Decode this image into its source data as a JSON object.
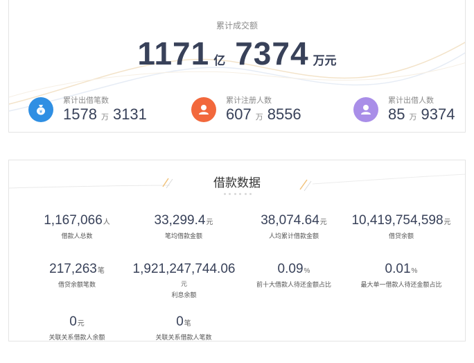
{
  "summary": {
    "caption": "累计成交额",
    "amount_yi": "1171",
    "unit_yi": "亿",
    "amount_wan": "7374",
    "unit_wanyuan": "万元",
    "colors": {
      "number": "#384159",
      "accent_blue": "#2f8fe3",
      "accent_orange": "#f2683c",
      "accent_purple": "#a98ee8"
    }
  },
  "stats": [
    {
      "label": "累计出借笔数",
      "part1": "1578",
      "unit": "万",
      "part2": "3131",
      "icon": "money-bag-icon"
    },
    {
      "label": "累计注册人数",
      "part1": "607",
      "unit": "万",
      "part2": "8556",
      "icon": "user-icon"
    },
    {
      "label": "累计出借人数",
      "part1": "85",
      "unit": "万",
      "part2": "9374",
      "icon": "user-icon"
    }
  ],
  "loan": {
    "title": "借款数据",
    "items": [
      {
        "value": "1,167,066",
        "unit": "人",
        "label": "借款人总数"
      },
      {
        "value": "33,299.4",
        "unit": "元",
        "label": "笔均借款金额"
      },
      {
        "value": "38,074.64",
        "unit": "元",
        "label": "人均累计借款金额"
      },
      {
        "value": "10,419,754,598",
        "unit": "元",
        "label": "借贷余额"
      },
      {
        "value": "217,263",
        "unit": "笔",
        "label": "借贷余额笔数"
      },
      {
        "value": "1,921,247,744.06",
        "unit": "元",
        "label": "利息余额"
      },
      {
        "value": "0.09",
        "unit": "%",
        "label": "前十大借款人待还金额占比"
      },
      {
        "value": "0.01",
        "unit": "%",
        "label": "最大单一借款人待还金额占比"
      },
      {
        "value": "0",
        "unit": "元",
        "label": "关联关系借款人余额"
      },
      {
        "value": "0",
        "unit": "笔",
        "label": "关联关系借款人笔数"
      }
    ]
  }
}
